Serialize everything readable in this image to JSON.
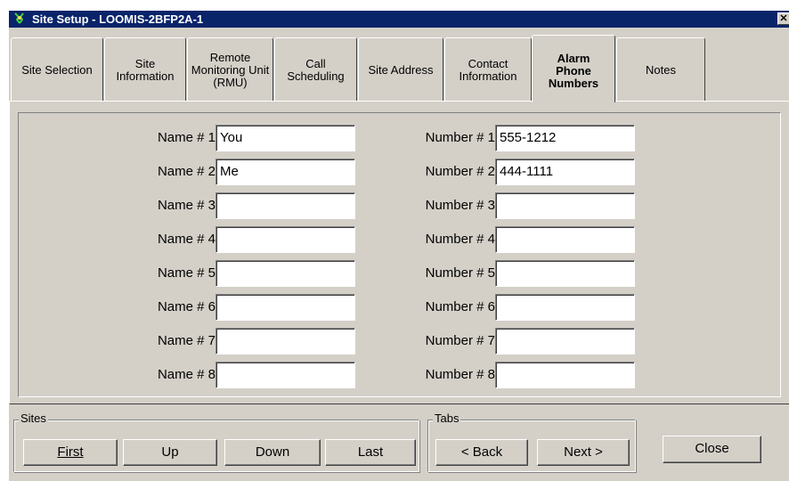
{
  "window": {
    "title": "Site Setup - LOOMIS-2BFP2A-1",
    "close_glyph": "✕"
  },
  "tabs": [
    {
      "label": "Site Selection",
      "active": false
    },
    {
      "label": "Site\nInformation",
      "active": false
    },
    {
      "label": "Remote\nMonitoring Unit\n(RMU)",
      "active": false
    },
    {
      "label": "Call\nScheduling",
      "active": false
    },
    {
      "label": "Site Address",
      "active": false
    },
    {
      "label": "Contact\nInformation",
      "active": false
    },
    {
      "label": "Alarm\nPhone\nNumbers",
      "active": true
    },
    {
      "label": "Notes",
      "active": false
    }
  ],
  "alarm_phone_numbers": {
    "rows": [
      {
        "name_label": "Name # 1",
        "name_value": "You",
        "number_label": "Number # 1",
        "number_value": "555-1212"
      },
      {
        "name_label": "Name # 2",
        "name_value": "Me",
        "number_label": "Number # 2",
        "number_value": "444-1111"
      },
      {
        "name_label": "Name # 3",
        "name_value": "",
        "number_label": "Number # 3",
        "number_value": ""
      },
      {
        "name_label": "Name # 4",
        "name_value": "",
        "number_label": "Number # 4",
        "number_value": ""
      },
      {
        "name_label": "Name # 5",
        "name_value": "",
        "number_label": "Number # 5",
        "number_value": ""
      },
      {
        "name_label": "Name # 6",
        "name_value": "",
        "number_label": "Number # 6",
        "number_value": ""
      },
      {
        "name_label": "Name # 7",
        "name_value": "",
        "number_label": "Number # 7",
        "number_value": ""
      },
      {
        "name_label": "Name # 8",
        "name_value": "",
        "number_label": "Number # 8",
        "number_value": ""
      }
    ]
  },
  "sites_group": {
    "legend": "Sites",
    "first": "First",
    "up": "Up",
    "down": "Down",
    "last": "Last"
  },
  "tabs_group": {
    "legend": "Tabs",
    "back": "< Back",
    "next": "Next >"
  },
  "close_button": "Close",
  "icons": {
    "app": "network-globe-icon"
  }
}
